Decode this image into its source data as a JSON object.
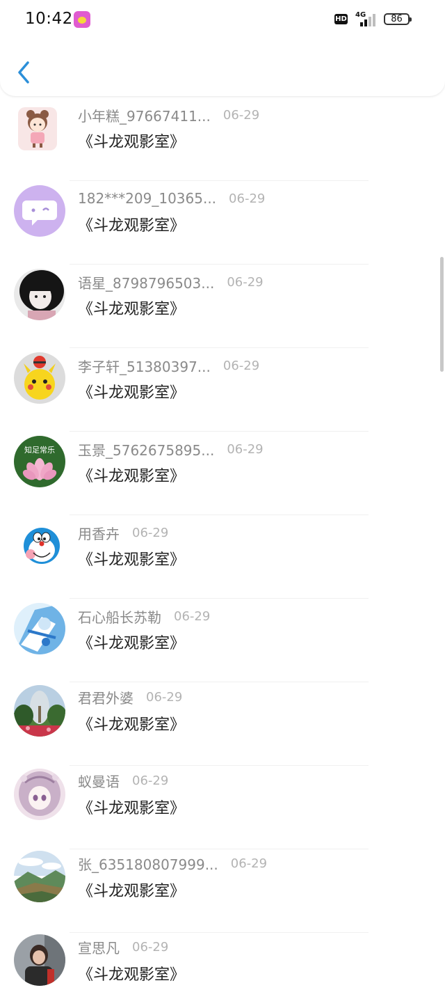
{
  "status_bar": {
    "time": "10:42",
    "hd_label": "HD",
    "network_label": "4G",
    "battery_level": "86"
  },
  "nav": {
    "back_icon": "chevron-left-icon"
  },
  "comments": [
    {
      "name": "小年糕_97667411...",
      "date": "06-29",
      "text": "《斗龙观影室》",
      "avatar_icon": "cartoon-girl-avatar",
      "avatar_color": "#f6dfe0"
    },
    {
      "name": "182***209_10365...",
      "date": "06-29",
      "text": "《斗龙观影室》",
      "avatar_icon": "chat-bubble-avatar",
      "avatar_color": "#cdb2ef"
    },
    {
      "name": "语星_8798796503...",
      "date": "06-29",
      "text": "《斗龙观影室》",
      "avatar_icon": "dark-hair-girl-avatar",
      "avatar_color": "#1c1c1c"
    },
    {
      "name": "李子轩_51380397...",
      "date": "06-29",
      "text": "《斗龙观影室》",
      "avatar_icon": "pikachu-avatar",
      "avatar_color": "#d9d9d9"
    },
    {
      "name": "玉景_5762675895...",
      "date": "06-29",
      "text": "《斗龙观影室》",
      "avatar_icon": "lotus-flower-avatar",
      "avatar_color": "#2f6a2d",
      "avatar_caption": "知足常乐"
    },
    {
      "name": "用香卉",
      "date": "06-29",
      "text": "《斗龙观影室》",
      "avatar_icon": "doraemon-avatar",
      "avatar_color": "#1f8fd8"
    },
    {
      "name": "石心船长苏勒",
      "date": "06-29",
      "text": "《斗龙观影室》",
      "avatar_icon": "anime-character-avatar",
      "avatar_color": "#6fb3e6"
    },
    {
      "name": "君君外婆",
      "date": "06-29",
      "text": "《斗龙观影室》",
      "avatar_icon": "garden-photo-avatar",
      "avatar_color": "#5c8f4a"
    },
    {
      "name": "蚁曼语",
      "date": "06-29",
      "text": "《斗龙观影室》",
      "avatar_icon": "anime-girl-avatar",
      "avatar_color": "#d9c3d6"
    },
    {
      "name": "张_635180807999...",
      "date": "06-29",
      "text": "《斗龙观影室》",
      "avatar_icon": "landscape-photo-avatar",
      "avatar_color": "#7aa6c9"
    },
    {
      "name": "宣思凡",
      "date": "06-29",
      "text": "《斗龙观影室》",
      "avatar_icon": "person-photo-avatar",
      "avatar_color": "#3a3a3a"
    }
  ]
}
